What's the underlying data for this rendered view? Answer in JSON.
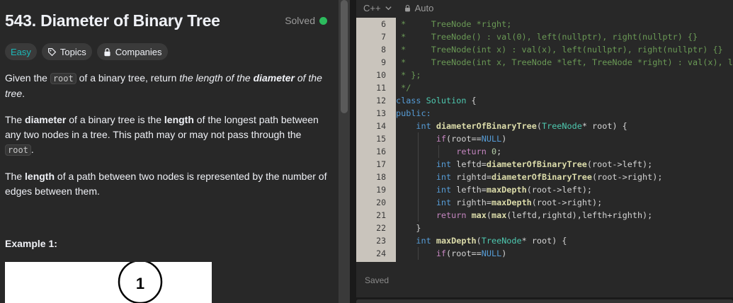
{
  "problem": {
    "title": "543. Diameter of Binary Tree",
    "status": "Solved",
    "status_color": "#2cbb5d",
    "tags": [
      {
        "label": "Easy",
        "icon": ""
      },
      {
        "label": "Topics",
        "icon": "tag-icon"
      },
      {
        "label": "Companies",
        "icon": "lock-icon"
      }
    ],
    "description": {
      "p1": {
        "a": "Given the ",
        "code": "root",
        "b": " of a binary tree, return ",
        "em1": "the length of the ",
        "strong": "diameter",
        "em2": " of the tree",
        "c": "."
      },
      "p2": {
        "a": "The ",
        "strong1": "diameter",
        "b": " of a binary tree is the ",
        "strong2": "length",
        "c": " of the longest path between any two nodes in a tree. This path may or may not pass through the ",
        "code": "root",
        "d": "."
      },
      "p3": {
        "a": "The ",
        "strong": "length",
        "b": " of a path between two nodes is represented by the number of edges between them."
      }
    },
    "example_heading": "Example 1:",
    "example_node": "1"
  },
  "editor": {
    "language": "C++",
    "mode": "Auto",
    "saved_label": "Saved",
    "line_numbers": [
      "6",
      "7",
      "8",
      "9",
      "10",
      "11",
      "12",
      "13",
      "14",
      "15",
      "16",
      "17",
      "18",
      "19",
      "20",
      "21",
      "22",
      "23",
      "24"
    ]
  },
  "code": {
    "c6": " *     TreeNode *right;",
    "c7": " *     TreeNode() : val(0), left(nullptr), right(nullptr) {}",
    "c8": " *     TreeNode(int x) : val(x), left(nullptr), right(nullptr) {}",
    "c9": " *     TreeNode(int x, TreeNode *left, TreeNode *right) : val(x), left(left), right(right) {}",
    "c10": " * };",
    "c11": " */",
    "kw_class": "class",
    "cls_solution": "Solution",
    "brace_open": " {",
    "kw_public": "public:",
    "kw_int": "int",
    "fn_diameter": "diameterOfBinaryTree",
    "paren_open": "(",
    "cls_treenode": "TreeNode",
    "ptr_root": "* root) {",
    "ptr_root2": "* root) {",
    "kw_if": "if",
    "root_eq": "(root==",
    "kw_null": "NULL",
    "close_paren": ")",
    "kw_return": "return",
    "num_zero": "0",
    "semi": ";",
    "v_leftd": " leftd=",
    "v_rightd": " rightd=",
    "v_lefth": " lefth=",
    "v_righth": " righth=",
    "arg_left": "(root->left);",
    "arg_right": "(root->right);",
    "fn_maxdepth": "maxDepth",
    "fn_max": "max",
    "max_args_a": "(",
    "max_args_b": "(leftd,rightd),lefth+righth);",
    "close_brace": "}"
  }
}
